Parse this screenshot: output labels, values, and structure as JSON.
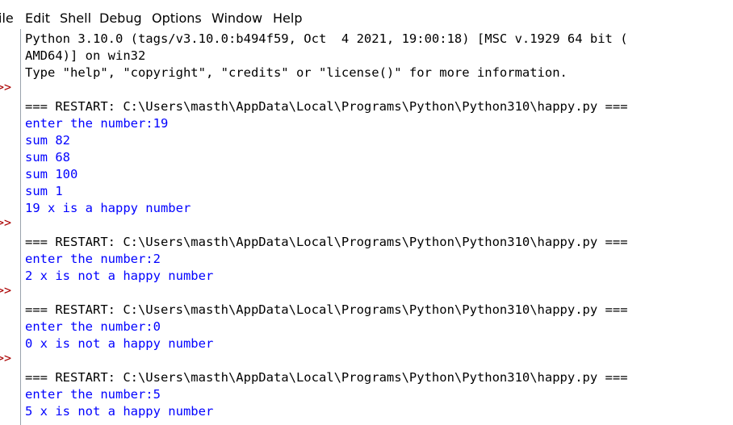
{
  "menu": {
    "file": "ile",
    "edit": "Edit",
    "shell": "Shell",
    "debug": "Debug",
    "options": "Options",
    "window": "Window",
    "help": "Help"
  },
  "prompt_glyph": ">>",
  "banner": {
    "line1": "Python 3.10.0 (tags/v3.10.0:b494f59, Oct  4 2021, 19:00:18) [MSC v.1929 64 bit (",
    "line2": "AMD64)] on win32",
    "line3": "Type \"help\", \"copyright\", \"credits\" or \"license()\" for more information."
  },
  "restart_line": "=== RESTART: C:\\Users\\masth\\AppData\\Local\\Programs\\Python\\Python310\\happy.py ===",
  "runs": [
    {
      "input_line": "enter the number:19",
      "output": [
        "sum 82",
        "sum 68",
        "sum 100",
        "sum 1",
        "19 x is a happy number"
      ]
    },
    {
      "input_line": "enter the number:2",
      "output": [
        "2 x is not a happy number"
      ]
    },
    {
      "input_line": "enter the number:0",
      "output": [
        "0 x is not a happy number"
      ]
    },
    {
      "input_line": "enter the number:5",
      "output": [
        "5 x is not a happy number"
      ]
    }
  ],
  "colors": {
    "stdout": "#0000ff",
    "prompt": "#aa0000",
    "banner": "#000000"
  }
}
